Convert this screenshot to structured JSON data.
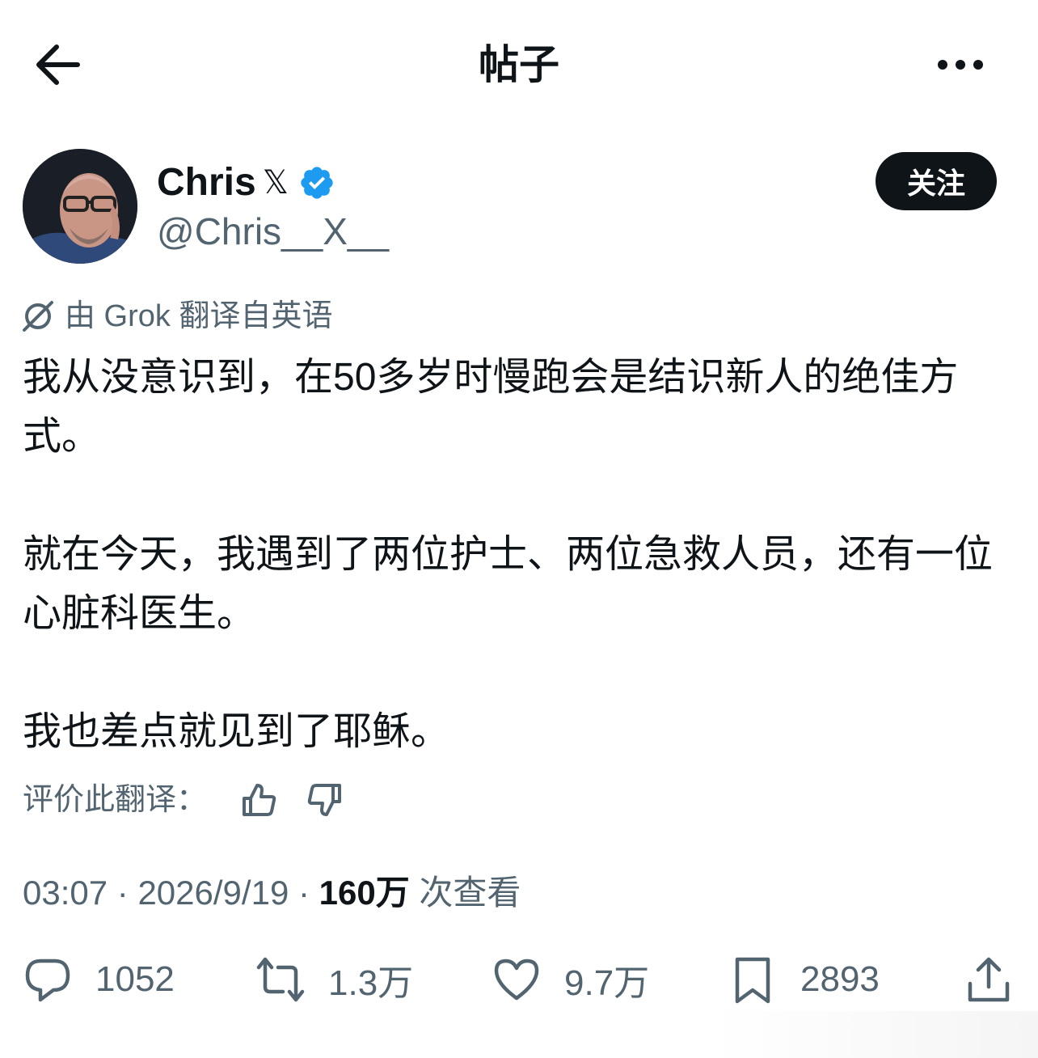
{
  "header": {
    "title": "帖子"
  },
  "author": {
    "display_name": "Chris",
    "name_suffix": "𝕏",
    "handle": "@Chris__X__",
    "verified": true
  },
  "follow_label": "关注",
  "translation_note": "由 Grok 翻译自英语",
  "tweet": {
    "paragraphs": [
      "我从没意识到，在50多岁时慢跑会是结识新人的绝佳方式。",
      "就在今天，我遇到了两位护士、两位急救人员，还有一位心脏科医生。",
      "我也差点就见到了耶稣。"
    ]
  },
  "rate_translation_label": "评价此翻译：",
  "meta": {
    "time": "03:07",
    "separator": "·",
    "date": "2026/9/19",
    "views_count": "160万",
    "views_label": "次查看"
  },
  "actions": {
    "replies": "1052",
    "reposts": "1.3万",
    "likes": "9.7万",
    "bookmarks": "2893"
  },
  "colors": {
    "verified": "#1d9bf0",
    "text": "#0f1419",
    "secondary": "#536471"
  }
}
